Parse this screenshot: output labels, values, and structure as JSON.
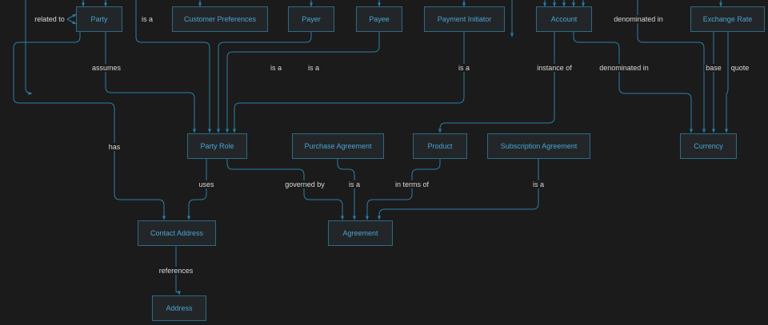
{
  "nodes": {
    "party": "Party",
    "customer_preferences": "Customer Preferences",
    "payer": "Payer",
    "payee": "Payee",
    "payment_initiator": "Payment Initiator",
    "account": "Account",
    "exchange_rate": "Exchange Rate",
    "party_role": "Party Role",
    "purchase_agreement": "Purchase Agreement",
    "product": "Product",
    "subscription_agreement": "Subscription Agreement",
    "currency": "Currency",
    "contact_address": "Contact Address",
    "agreement": "Agreement",
    "address": "Address"
  },
  "edge_labels": {
    "related_to": "related to",
    "party_is_a": "is a",
    "denominated_in_top": "denominated in",
    "assumes": "assumes",
    "payer_is_a": "is a",
    "payee_is_a": "is a",
    "initiator_is_a": "is a",
    "instance_of": "instance of",
    "denominated_in": "denominated in",
    "base": "base",
    "quote": "quote",
    "has": "has",
    "uses": "uses",
    "governed_by": "governed by",
    "purchase_is_a": "is a",
    "in_terms_of": "in terms of",
    "subscription_is_a": "is a",
    "references": "references"
  },
  "colors": {
    "background": "#1b1b1b",
    "edge": "#2a7fa8",
    "node_border": "#2c6a86",
    "node_fill": "#232628",
    "node_text": "#4aa3d1",
    "label_text": "#d8d8d8"
  }
}
